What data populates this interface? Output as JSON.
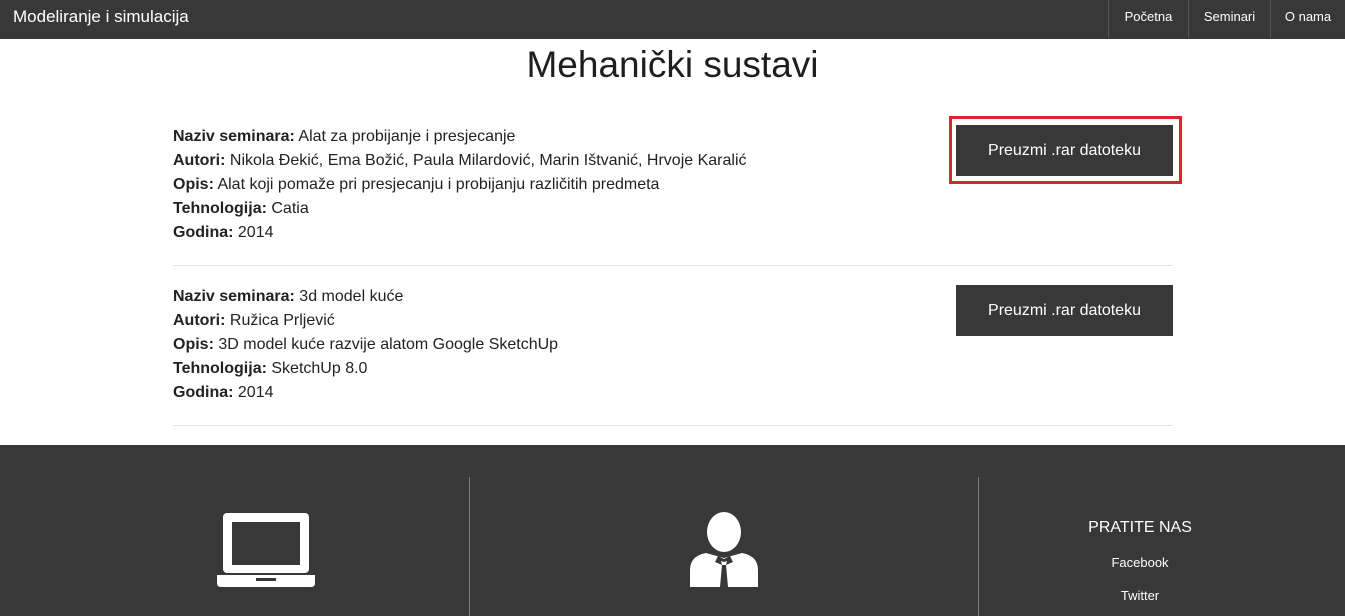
{
  "navbar": {
    "brand": "Modeliranje i simulacija",
    "items": [
      "Početna",
      "Seminari",
      "O nama"
    ]
  },
  "page": {
    "title": "Mehanički sustavi"
  },
  "labels": {
    "naziv": "Naziv seminara:",
    "autori": "Autori:",
    "opis": "Opis:",
    "tehnologija": "Tehnologija:",
    "godina": "Godina:"
  },
  "seminars": [
    {
      "naziv": "Alat za probijanje i presjecanje",
      "autori": "Nikola Đekić, Ema Božić, Paula Milardović, Marin Ištvanić, Hrvoje Karalić",
      "opis": "Alat koji pomaže pri presjecanju i probijanju različitih predmeta",
      "tehnologija": "Catia",
      "godina": "2014",
      "button": "Preuzmi .rar datoteku"
    },
    {
      "naziv": "3d model kuće",
      "autori": "Ružica Prljević",
      "opis": "3D model kuće razvije alatom Google SketchUp",
      "tehnologija": "SketchUp 8.0",
      "godina": "2014",
      "button": "Preuzmi .rar datoteku"
    }
  ],
  "footer": {
    "icons": [
      "laptop-icon",
      "person-icon"
    ],
    "follow_title": "PRATITE NAS",
    "social": [
      "Facebook",
      "Twitter"
    ]
  },
  "colors": {
    "dark": "#383838",
    "highlight": "#d9262c"
  }
}
